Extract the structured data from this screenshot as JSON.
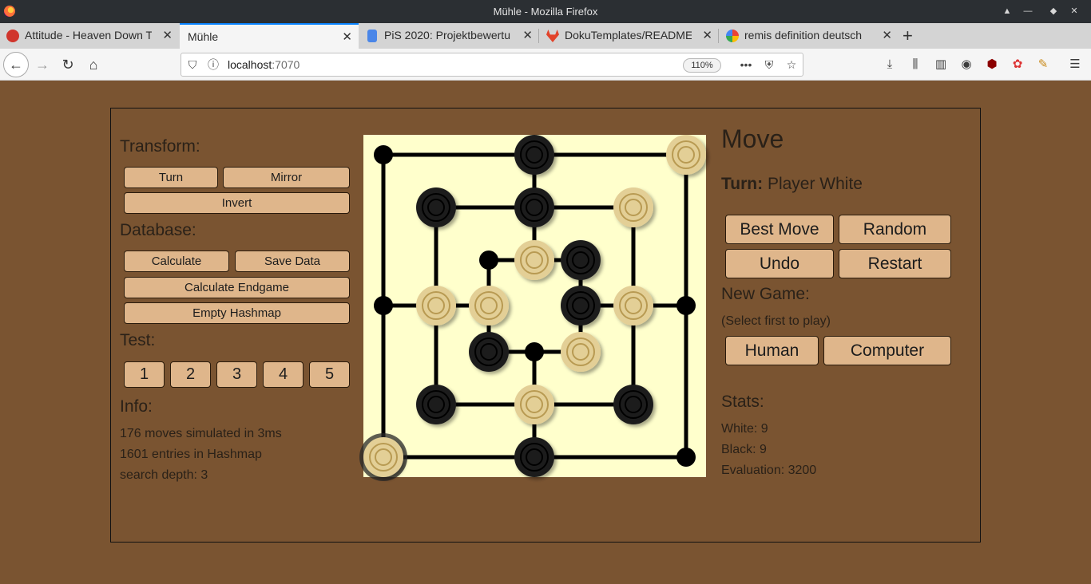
{
  "window": {
    "title": "Mühle - Mozilla Firefox"
  },
  "tabs": [
    {
      "label": "Attitude - Heaven Down T",
      "favicon_color": "#d0352c"
    },
    {
      "label": "Mühle",
      "favicon_color": ""
    },
    {
      "label": "PiS 2020: Projektbewertu",
      "favicon_color": "#4a86e8"
    },
    {
      "label": "DokuTemplates/README",
      "favicon_color": "#e2432a"
    },
    {
      "label": "remis definition deutsch",
      "favicon_color": "#4285f4"
    }
  ],
  "navbar": {
    "url_host": "localhost",
    "url_port": ":7070",
    "zoom": "110%"
  },
  "left": {
    "transform_heading": "Transform:",
    "turn_label": "Turn",
    "mirror_label": "Mirror",
    "invert_label": "Invert",
    "database_heading": "Database:",
    "calculate_label": "Calculate",
    "save_data_label": "Save Data",
    "calculate_endgame_label": "Calculate Endgame",
    "empty_hashmap_label": "Empty Hashmap",
    "test_heading": "Test:",
    "tests": [
      "1",
      "2",
      "3",
      "4",
      "5"
    ],
    "info_heading": "Info:",
    "info_lines": [
      "176 moves simulated in 3ms",
      "1601 entries in Hashmap",
      "search depth: 3"
    ]
  },
  "right": {
    "move_heading": "Move",
    "turn_prefix": "Turn:",
    "turn_value": "Player White",
    "best_move_label": "Best Move",
    "random_label": "Random",
    "undo_label": "Undo",
    "restart_label": "Restart",
    "new_game_heading": "New Game:",
    "new_game_hint": "(Select first to play)",
    "human_label": "Human",
    "computer_label": "Computer",
    "stats_heading": "Stats:",
    "stats_white": "White: 9",
    "stats_black": "Black: 9",
    "stats_eval": "Evaluation: 3200"
  },
  "board": {
    "colors": {
      "background": "#ffffcc",
      "line": "#000000",
      "white_piece": "#e3cf96",
      "black_piece": "#1e1e1e"
    },
    "pieces": [
      {
        "ring": "outer",
        "pos": "top-left",
        "color": "empty"
      },
      {
        "ring": "outer",
        "pos": "top",
        "color": "black"
      },
      {
        "ring": "outer",
        "pos": "top-right",
        "color": "white"
      },
      {
        "ring": "outer",
        "pos": "right",
        "color": "empty"
      },
      {
        "ring": "outer",
        "pos": "bottom-right",
        "color": "empty"
      },
      {
        "ring": "outer",
        "pos": "bottom",
        "color": "black"
      },
      {
        "ring": "outer",
        "pos": "bottom-left",
        "color": "white",
        "selected": true
      },
      {
        "ring": "outer",
        "pos": "left",
        "color": "empty"
      },
      {
        "ring": "middle",
        "pos": "top-left",
        "color": "black"
      },
      {
        "ring": "middle",
        "pos": "top",
        "color": "black"
      },
      {
        "ring": "middle",
        "pos": "top-right",
        "color": "white"
      },
      {
        "ring": "middle",
        "pos": "right",
        "color": "white"
      },
      {
        "ring": "middle",
        "pos": "bottom-right",
        "color": "black"
      },
      {
        "ring": "middle",
        "pos": "bottom",
        "color": "white"
      },
      {
        "ring": "middle",
        "pos": "bottom-left",
        "color": "black"
      },
      {
        "ring": "middle",
        "pos": "left",
        "color": "white"
      },
      {
        "ring": "inner",
        "pos": "top-left",
        "color": "empty"
      },
      {
        "ring": "inner",
        "pos": "top",
        "color": "white"
      },
      {
        "ring": "inner",
        "pos": "top-right",
        "color": "black"
      },
      {
        "ring": "inner",
        "pos": "right",
        "color": "black"
      },
      {
        "ring": "inner",
        "pos": "bottom-right",
        "color": "white"
      },
      {
        "ring": "inner",
        "pos": "bottom",
        "color": "empty"
      },
      {
        "ring": "inner",
        "pos": "bottom-left",
        "color": "black"
      },
      {
        "ring": "inner",
        "pos": "left",
        "color": "white"
      }
    ]
  }
}
